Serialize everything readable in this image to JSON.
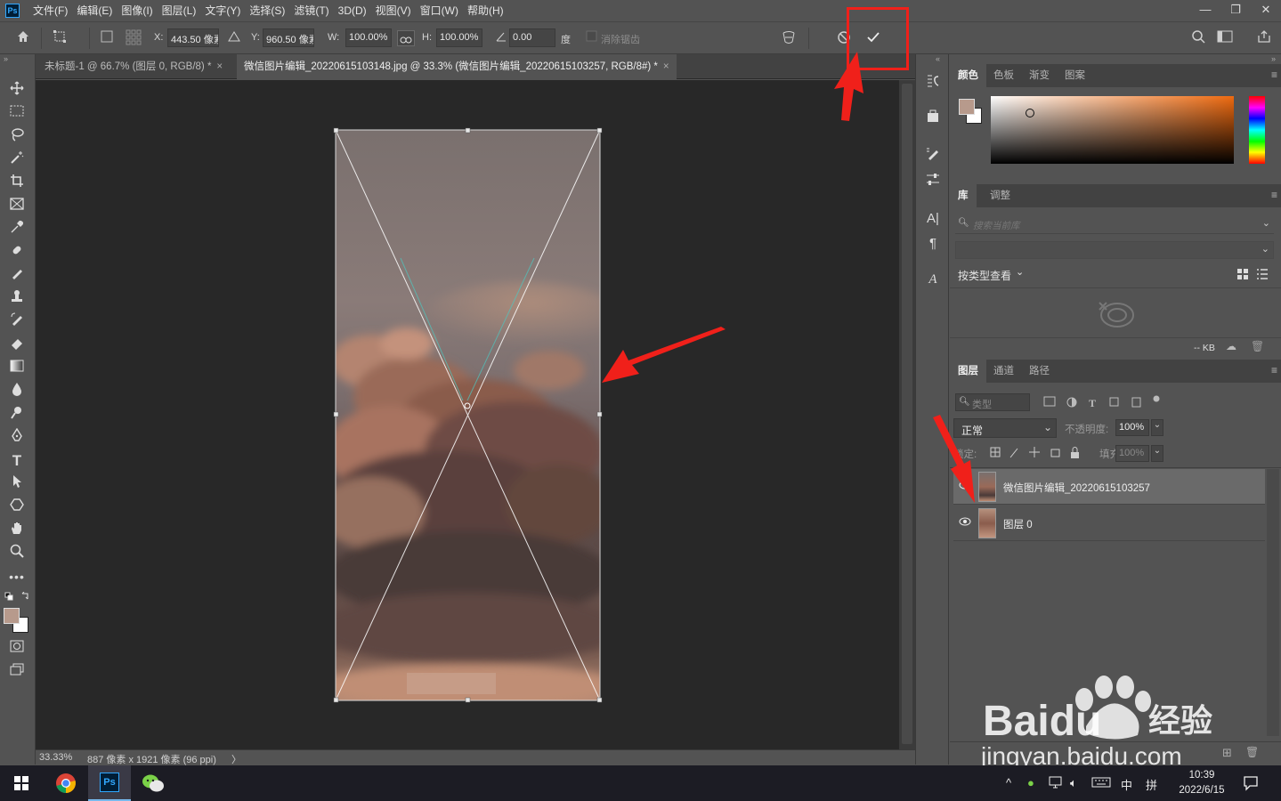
{
  "menubar": {
    "app_icon": "Ps",
    "items": [
      "文件(F)",
      "编辑(E)",
      "图像(I)",
      "图层(L)",
      "文字(Y)",
      "选择(S)",
      "滤镜(T)",
      "3D(D)",
      "视图(V)",
      "窗口(W)",
      "帮助(H)"
    ],
    "window_buttons": [
      "—",
      "❐",
      "✕"
    ]
  },
  "options": {
    "x_label": "X:",
    "x_value": "443.50 像素",
    "y_label": "Y:",
    "y_value": "960.50 像素",
    "w_label": "W:",
    "w_value": "100.00%",
    "h_label": "H:",
    "h_value": "100.00%",
    "angle_value": "0.00",
    "angle_unit": "度",
    "antialias_label": "消除锯齿",
    "commit_icon": "checkmark-icon",
    "cancel_icon": "cancel-icon"
  },
  "tabs": [
    {
      "label": "未标题-1 @ 66.7% (图层 0, RGB/8) *",
      "close": "×"
    },
    {
      "label": "微信图片编辑_20220615103148.jpg @ 33.3% (微信图片编辑_20220615103257, RGB/8#) *",
      "close": "×"
    }
  ],
  "status": {
    "zoom": "33.33%",
    "doc_info": "887 像素 x 1921 像素 (96 ppi)",
    "arrow": "〉"
  },
  "color_panel": {
    "tabs": [
      "颜色",
      "色板",
      "渐变",
      "图案"
    ],
    "foreground": "#b79a8c",
    "background": "#ffffff"
  },
  "library_panel": {
    "tabs": [
      "库",
      "调整"
    ],
    "search_placeholder": "搜索当前库",
    "view_label": "按类型查看",
    "size_label": "-- KB"
  },
  "layers_panel": {
    "tabs": [
      "图层",
      "通道",
      "路径"
    ],
    "filter_label": "类型",
    "blend_mode": "正常",
    "opacity_label": "不透明度:",
    "opacity_value": "100%",
    "lock_label": "锁定:",
    "fill_label": "填充:",
    "fill_value": "100%",
    "layers": [
      {
        "name": "微信图片编辑_20220615103257",
        "selected": true
      },
      {
        "name": "图层 0",
        "selected": false
      }
    ]
  },
  "taskbar": {
    "time": "10:39",
    "date": "2022/6/15",
    "ime": "中",
    "ime2": "拼"
  },
  "watermark": {
    "brand": "Baidu",
    "brand_cn": "经验",
    "url": "jingyan.baidu.com"
  },
  "colors": {
    "annotation_red": "#f0201a",
    "transform_line": "#ffffff",
    "accent": "#31a8ff"
  }
}
